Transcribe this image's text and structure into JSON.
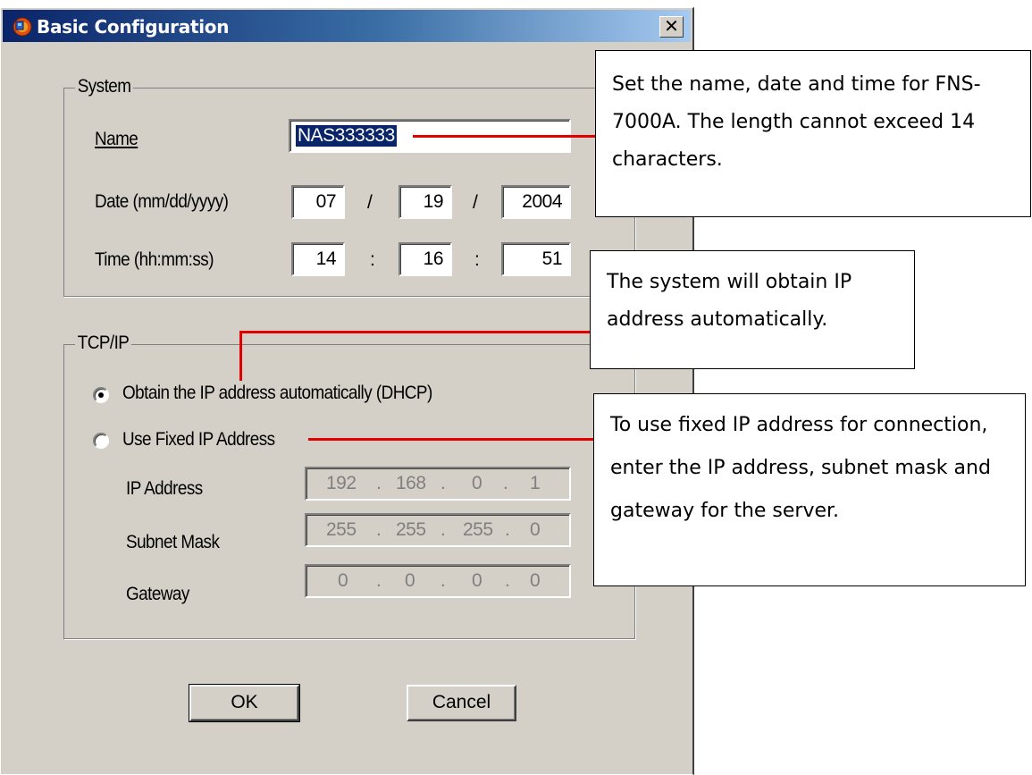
{
  "window": {
    "title": "Basic Configuration",
    "close_glyph": "✕"
  },
  "system": {
    "group_label": "System",
    "name_label": "Name",
    "name_value": "NAS333333",
    "date_label": "Date (mm/dd/yyyy)",
    "date_month": "07",
    "date_day": "19",
    "date_year": "2004",
    "date_sep": "/",
    "time_label": "Time (hh:mm:ss)",
    "time_hour": "14",
    "time_min": "16",
    "time_sec": "51",
    "time_sep": ":"
  },
  "tcpip": {
    "group_label": "TCP/IP",
    "dhcp_label": "Obtain the IP address automatically (DHCP)",
    "dhcp_selected": true,
    "fixed_label": "Use Fixed IP Address",
    "ip_label": "IP Address",
    "ip_value": [
      "192",
      "168",
      "0",
      "1"
    ],
    "subnet_label": "Subnet Mask",
    "subnet_value": [
      "255",
      "255",
      "255",
      "0"
    ],
    "gateway_label": "Gateway",
    "gateway_value": [
      "0",
      "0",
      "0",
      "0"
    ],
    "dot": "."
  },
  "buttons": {
    "ok": "OK",
    "cancel": "Cancel"
  },
  "callouts": {
    "system": "Set the name, date and time for FNS-7000A.  The length cannot exceed 14 characters.",
    "dhcp": "The system will obtain IP address automatically.",
    "fixed": "To use fixed IP address for connection, enter the IP address, subnet mask and gateway for the server."
  },
  "colors": {
    "titlebar_start": "#0a246a",
    "titlebar_end": "#a6caf0",
    "dialog_bg": "#d4d0c8",
    "callout_line": "#e00000"
  }
}
